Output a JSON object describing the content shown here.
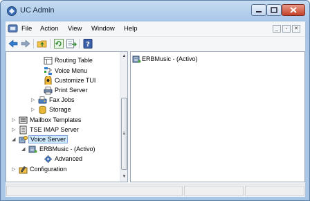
{
  "window": {
    "title": "UC Admin"
  },
  "menubar": {
    "items": [
      "File",
      "Action",
      "View",
      "Window",
      "Help"
    ]
  },
  "tree": {
    "items": [
      {
        "label": "Routing Table"
      },
      {
        "label": "Voice Menu"
      },
      {
        "label": "Customize TUI"
      },
      {
        "label": "Print Server"
      },
      {
        "label": "Fax Jobs"
      },
      {
        "label": "Storage"
      },
      {
        "label": "Mailbox Templates"
      },
      {
        "label": "TSE IMAP Server"
      },
      {
        "label": "Voice Server"
      },
      {
        "label": "ERBMusic - (Activo)"
      },
      {
        "label": "Advanced"
      },
      {
        "label": "Configuration"
      }
    ]
  },
  "detail": {
    "items": [
      {
        "label": "ERBMusic - (Activo)"
      }
    ]
  },
  "icons": {
    "app": "uc-admin-icon",
    "back": "back-arrow-icon",
    "forward": "forward-arrow-icon",
    "up": "folder-up-icon",
    "refresh": "refresh-icon",
    "export": "export-list-icon",
    "help": "help-icon"
  },
  "colors": {
    "selection": "#cde8ff",
    "titlebar": "#a8c6e8",
    "close": "#c5412a"
  }
}
